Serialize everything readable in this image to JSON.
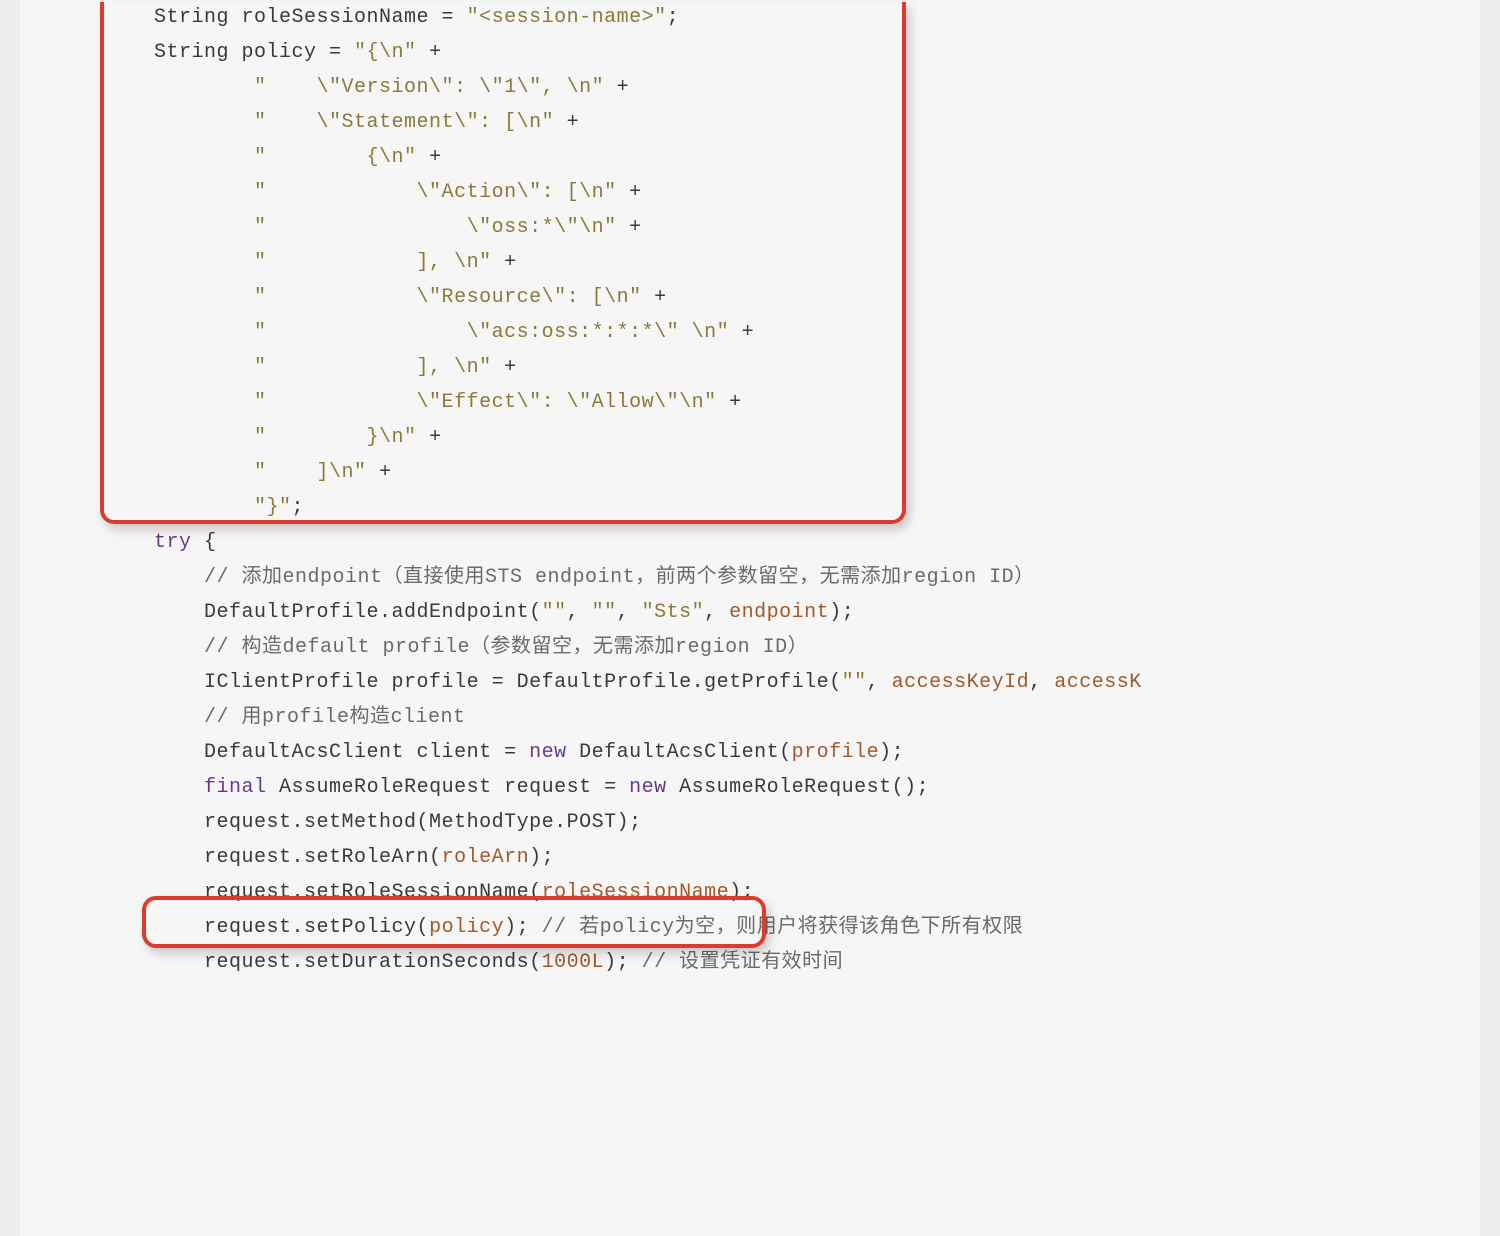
{
  "code": {
    "line01_a": "String roleSessionName = ",
    "line01_b": "\"<session-name>\"",
    "line01_c": ";",
    "line02_a": "String policy = ",
    "line02_b": "\"{\\n\"",
    "line02_c": " +",
    "line03_a": "        ",
    "line03_b": "\"    \\\"Version\\\": \\\"1\\\", \\n\"",
    "line03_c": " +",
    "line04_a": "        ",
    "line04_b": "\"    \\\"Statement\\\": [\\n\"",
    "line04_c": " +",
    "line05_a": "        ",
    "line05_b": "\"        {\\n\"",
    "line05_c": " +",
    "line06_a": "        ",
    "line06_b": "\"            \\\"Action\\\": [\\n\"",
    "line06_c": " +",
    "line07_a": "        ",
    "line07_b": "\"                \\\"oss:*\\\"\\n\"",
    "line07_c": " +",
    "line08_a": "        ",
    "line08_b": "\"            ], \\n\"",
    "line08_c": " +",
    "line09_a": "        ",
    "line09_b": "\"            \\\"Resource\\\": [\\n\"",
    "line09_c": " +",
    "line10_a": "        ",
    "line10_b": "\"                \\\"acs:oss:*:*:*\\\" \\n\"",
    "line10_c": " +",
    "line11_a": "        ",
    "line11_b": "\"            ], \\n\"",
    "line11_c": " +",
    "line12_a": "        ",
    "line12_b": "\"            \\\"Effect\\\": \\\"Allow\\\"\\n\"",
    "line12_c": " +",
    "line13_a": "        ",
    "line13_b": "\"        }\\n\"",
    "line13_c": " +",
    "line14_a": "        ",
    "line14_b": "\"    ]\\n\"",
    "line14_c": " +",
    "line15_a": "        ",
    "line15_b": "\"}\"",
    "line15_c": ";",
    "line16_a": "try",
    "line16_b": " {",
    "line17": "    // 添加endpoint（直接使用STS endpoint，前两个参数留空，无需添加region ID）",
    "line18_a": "    DefaultProfile.addEndpoint(",
    "line18_b": "\"\"",
    "line18_c": ", ",
    "line18_d": "\"\"",
    "line18_e": ", ",
    "line18_f": "\"Sts\"",
    "line18_g": ", ",
    "line18_h": "endpoint",
    "line18_i": ");",
    "line19": "    // 构造default profile（参数留空，无需添加region ID）",
    "line20_a": "    IClientProfile profile = DefaultProfile.getProfile(",
    "line20_b": "\"\"",
    "line20_c": ", ",
    "line20_d": "accessKeyId",
    "line20_e": ", ",
    "line20_f": "accessK",
    "line21": "    // 用profile构造client",
    "line22_a": "    DefaultAcsClient client = ",
    "line22_b": "new",
    "line22_c": " DefaultAcsClient(",
    "line22_d": "profile",
    "line22_e": ");",
    "line23_a": "    ",
    "line23_b": "final",
    "line23_c": " AssumeRoleRequest request = ",
    "line23_d": "new",
    "line23_e": " AssumeRoleRequest();",
    "line24": "    request.setMethod(MethodType.POST);",
    "line25_a": "    request.setRoleArn(",
    "line25_b": "roleArn",
    "line25_c": ");",
    "line26_a": "    request.setRoleSessionName(",
    "line26_b": "roleSessionName",
    "line26_c": ");",
    "line27_a": "    request.setPolicy(",
    "line27_b": "policy",
    "line27_c": "); ",
    "line27_d": "// 若policy为空，则用户将获得该角色下所有权限",
    "line28_a": "    request.setDurationSeconds(",
    "line28_b": "1000L",
    "line28_c": "); ",
    "line28_d": "// 设置凭证有效时间"
  },
  "indent1": "        ",
  "indent2": "    "
}
